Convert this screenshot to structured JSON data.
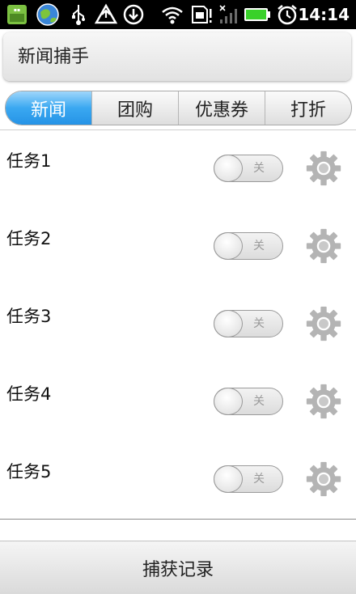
{
  "status_bar": {
    "time": "14:14",
    "icons": [
      "app-icon",
      "globe-icon",
      "usb-icon",
      "warning-icon",
      "download-icon",
      "wifi-icon",
      "sim-icon",
      "signal-icon",
      "battery-icon",
      "alarm-icon"
    ]
  },
  "header": {
    "title": "新闻捕手"
  },
  "tabs": [
    {
      "label": "新闻",
      "active": true
    },
    {
      "label": "团购",
      "active": false
    },
    {
      "label": "优惠券",
      "active": false
    },
    {
      "label": "打折",
      "active": false
    }
  ],
  "tasks": [
    {
      "label": "任务1",
      "toggle": "关"
    },
    {
      "label": "任务2",
      "toggle": "关"
    },
    {
      "label": "任务3",
      "toggle": "关"
    },
    {
      "label": "任务4",
      "toggle": "关"
    },
    {
      "label": "任务5",
      "toggle": "关"
    }
  ],
  "footer": {
    "button_label": "捕获记录"
  },
  "colors": {
    "accent": "#2f9fed",
    "status_bar_bg": "#000000",
    "battery": "#39d12a"
  }
}
